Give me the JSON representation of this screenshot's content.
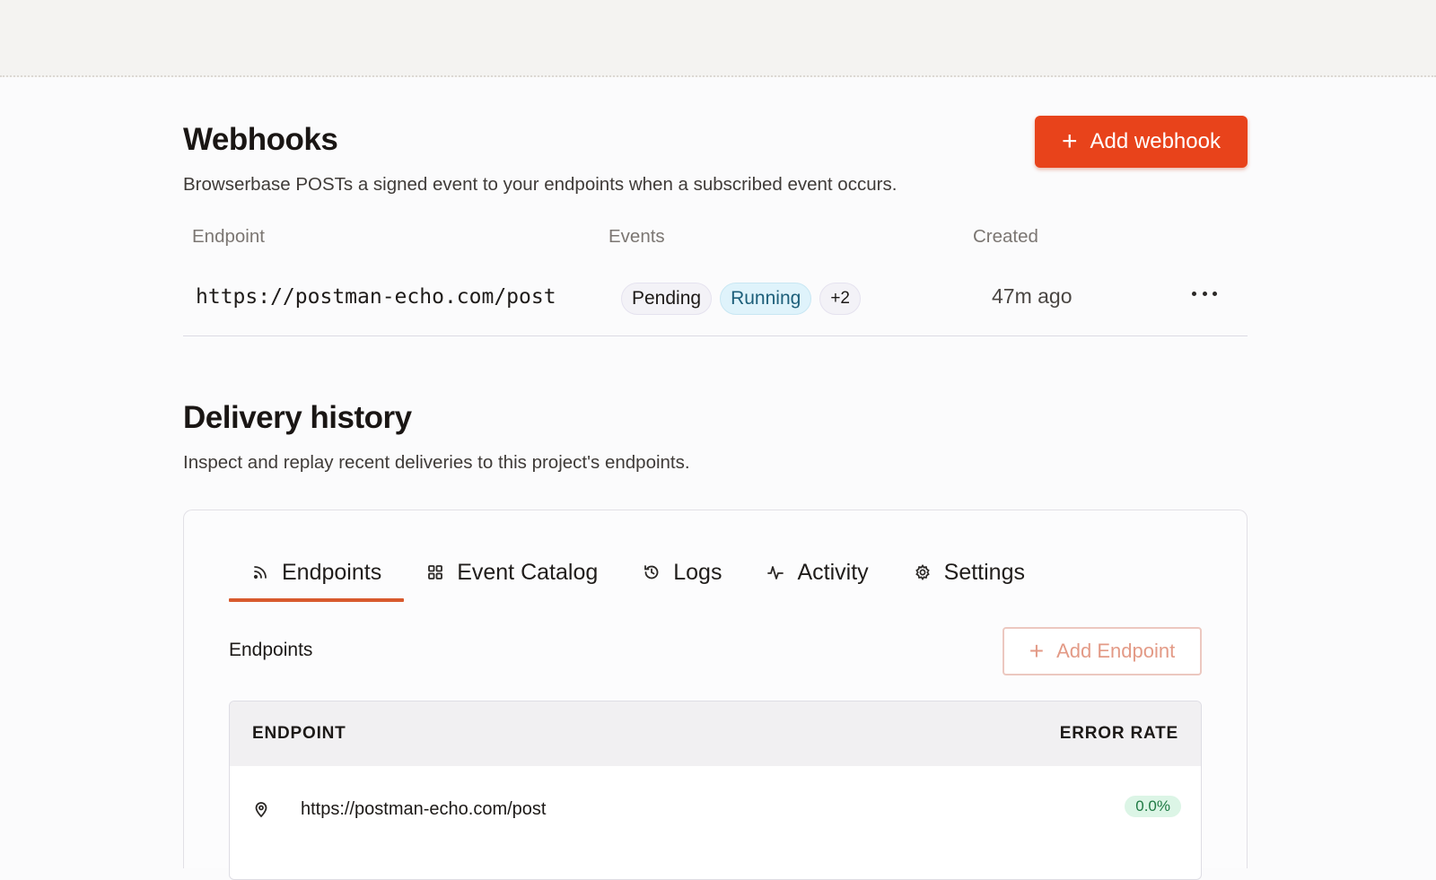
{
  "webhooks": {
    "title": "Webhooks",
    "subtitle": "Browserbase POSTs a signed event to your endpoints when a subscribed event occurs.",
    "add_button": "Add webhook",
    "columns": {
      "endpoint": "Endpoint",
      "events": "Events",
      "created": "Created"
    },
    "rows": [
      {
        "url": "https://postman-echo.com/post",
        "events": [
          "Pending",
          "Running"
        ],
        "more_events": "+2",
        "created": "47m ago"
      }
    ]
  },
  "delivery": {
    "title": "Delivery history",
    "subtitle": "Inspect and replay recent deliveries to this project's endpoints.",
    "tabs": [
      {
        "label": "Endpoints",
        "icon": "rss-icon",
        "active": true
      },
      {
        "label": "Event Catalog",
        "icon": "grid-icon",
        "active": false
      },
      {
        "label": "Logs",
        "icon": "history-icon",
        "active": false
      },
      {
        "label": "Activity",
        "icon": "activity-icon",
        "active": false
      },
      {
        "label": "Settings",
        "icon": "gear-icon",
        "active": false
      }
    ],
    "section_label": "Endpoints",
    "add_endpoint_button": "Add Endpoint",
    "table": {
      "col_endpoint": "ENDPOINT",
      "col_error_rate": "ERROR RATE",
      "rows": [
        {
          "url": "https://postman-echo.com/post",
          "error_rate": "0.0%"
        }
      ]
    }
  },
  "colors": {
    "accent": "#e8431b",
    "tab_underline": "#d85a2d",
    "running_badge": "#dff3fb"
  }
}
